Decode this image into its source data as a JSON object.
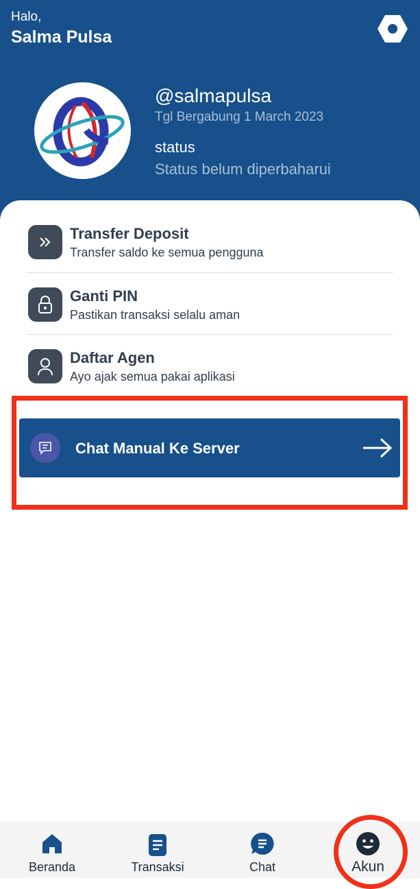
{
  "header": {
    "greeting": "Halo,",
    "name": "Salma Pulsa",
    "username": "@salmapulsa",
    "joined": "Tgl Bergabung 1 March 2023",
    "status_label": "status",
    "status_value": "Status belum diperbaharui",
    "settings_icon": "hexagon-settings-icon",
    "background_color": "#17508a"
  },
  "menu": [
    {
      "icon": "double-chevron-right-icon",
      "title": "Transfer Deposit",
      "subtitle": "Transfer saldo ke semua pengguna"
    },
    {
      "icon": "lock-icon",
      "title": "Ganti PIN",
      "subtitle": "Pastikan transaksi selalu aman"
    },
    {
      "icon": "user-icon",
      "title": "Daftar Agen",
      "subtitle": "Ayo ajak semua pakai aplikasi"
    }
  ],
  "chat_button": {
    "label": "Chat Manual Ke Server",
    "icon": "message-icon",
    "arrow_icon": "arrow-right-icon"
  },
  "highlight_color": "#f0301a",
  "bottom_nav": [
    {
      "label": "Beranda",
      "icon": "home-icon"
    },
    {
      "label": "Transaksi",
      "icon": "receipt-icon"
    },
    {
      "label": "Chat",
      "icon": "chat-icon"
    },
    {
      "label": "Akun",
      "icon": "smiley-icon",
      "active": true
    }
  ]
}
